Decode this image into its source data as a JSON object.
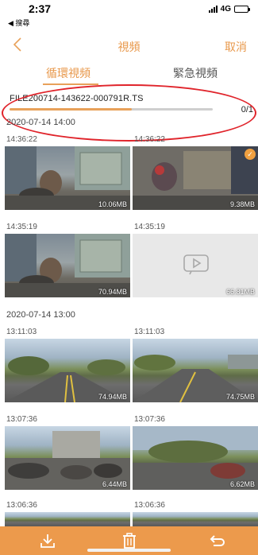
{
  "status_bar": {
    "time": "2:37",
    "back_app": "◀ 搜尋",
    "network": "4G"
  },
  "nav": {
    "back_icon": "chevron-left-icon",
    "title": "視頻",
    "cancel_label": "取消"
  },
  "tabs": {
    "loop_label": "循環視頻",
    "emergency_label": "緊急視頻"
  },
  "download": {
    "filename": "FILE200714-143622-000791R.TS",
    "progress": 0.6,
    "count": "0/1"
  },
  "groups": [
    {
      "date": "2020-07-14 14:00",
      "clips": [
        {
          "time": "14:36:22",
          "size": "10.06MB",
          "selected": false
        },
        {
          "time": "14:36:22",
          "size": "9.38MB",
          "selected": true
        },
        {
          "time": "14:35:19",
          "size": "70.94MB",
          "selected": false
        },
        {
          "time": "14:35:19",
          "size": "66.81MB",
          "selected": false
        }
      ]
    },
    {
      "date": "2020-07-14 13:00",
      "clips": [
        {
          "time": "13:11:03",
          "size": "74.94MB",
          "selected": false
        },
        {
          "time": "13:11:03",
          "size": "74.75MB",
          "selected": false
        },
        {
          "time": "13:07:36",
          "size": "6.44MB",
          "selected": false
        },
        {
          "time": "13:07:36",
          "size": "6.62MB",
          "selected": false
        },
        {
          "time": "13:06:36",
          "size": "",
          "selected": false
        },
        {
          "time": "13:06:36",
          "size": "",
          "selected": false
        }
      ]
    }
  ],
  "toolbar": {
    "download_icon": "download-icon",
    "delete_icon": "trash-icon",
    "undo_icon": "undo-icon"
  },
  "colors": {
    "accent": "#e8984b",
    "toolbar": "#ec9a4c",
    "highlight_oval": "#e0242b"
  }
}
